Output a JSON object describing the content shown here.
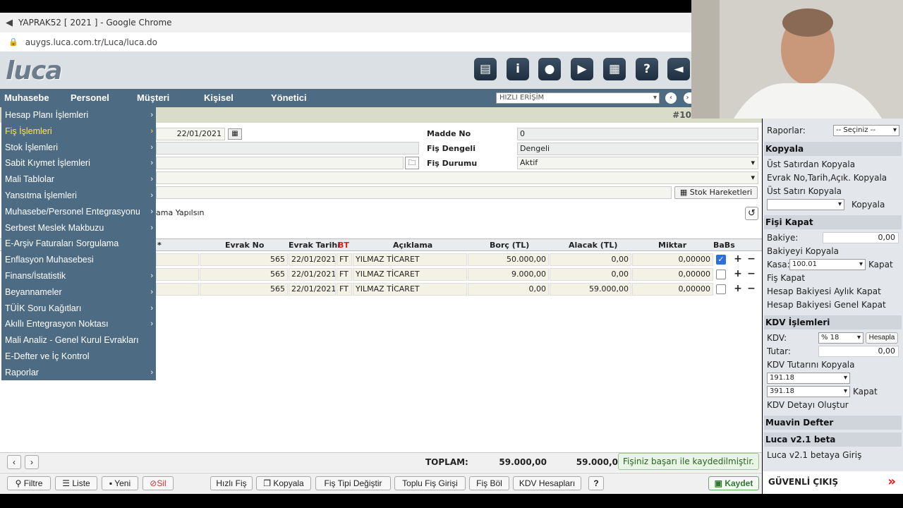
{
  "browser": {
    "title": "YAPRAK52 [ 2021 ] - Google Chrome",
    "url": "auygs.luca.com.tr/Luca/luca.do"
  },
  "logo": "luca",
  "toolbar_icons": [
    "book-icon",
    "info-icon",
    "globe-icon",
    "youtube-icon",
    "calculator-icon",
    "help-icon",
    "megaphone-icon"
  ],
  "nav": {
    "items": [
      "Muhasebe",
      "Personel",
      "Müşteri",
      "Kişisel",
      "Yönetici"
    ],
    "quick_access": "HIZLI ERİŞİM"
  },
  "fis_number": "#10",
  "form": {
    "date": "22/01/2021",
    "madde_no_label": "Madde No",
    "madde_no": "0",
    "fis_dengeli_label": "Fiş Dengeli",
    "fis_dengeli": "Dengeli",
    "fis_durumu_label": "Fiş Durumu",
    "fis_durumu": "Aktif",
    "stok_button": "Stok Hareketleri",
    "partial_text": "ama Yapılsın"
  },
  "grid": {
    "headers": [
      "*",
      "Evrak No",
      "Evrak Tarihi",
      "BT",
      "Açıklama",
      "Borç (TL)",
      "Alacak (TL)",
      "Miktar",
      "BaBs"
    ],
    "rows": [
      {
        "evrak_no": "565",
        "tarih": "22/01/2021",
        "bt": "FT",
        "aciklama": "YILMAZ TİCARET",
        "borc": "50.000,00",
        "alacak": "0,00",
        "miktar": "0,00000",
        "babs": true
      },
      {
        "evrak_no": "565",
        "tarih": "22/01/2021",
        "bt": "FT",
        "aciklama": "YILMAZ TİCARET",
        "borc": "9.000,00",
        "alacak": "0,00",
        "miktar": "0,00000",
        "babs": false
      },
      {
        "evrak_no": "565",
        "tarih": "22/01/2021",
        "bt": "FT",
        "aciklama": "YILMAZ TİCARET",
        "borc": "0,00",
        "alacak": "59.000,00",
        "miktar": "0,00000",
        "babs": false
      }
    ]
  },
  "menu": {
    "items": [
      "Hesap Planı İşlemleri",
      "Fiş İşlemleri",
      "Stok İşlemleri",
      "Sabit Kıymet İşlemleri",
      "Mali Tablolar",
      "Yansıtma İşlemleri",
      "Muhasebe/Personel Entegrasyonu",
      "Serbest Meslek Makbuzu",
      "E-Arşiv Faturaları Sorgulama",
      "Enflasyon Muhasebesi",
      "Finans/İstatistik",
      "Beyannameler",
      "TÜİK Soru Kağıtları",
      "Akıllı Entegrasyon Noktası",
      "Mali Analiz - Genel Kurul Evrakları",
      "E-Defter ve İç Kontrol",
      "Raporlar"
    ]
  },
  "totals": {
    "label": "TOPLAM:",
    "borc": "59.000,00",
    "alacak": "59.000,0"
  },
  "toast": "Fişiniz başarı ile kaydedilmiştir.",
  "bottom_buttons": {
    "filtre": "Filtre",
    "liste": "Liste",
    "yeni": "Yeni",
    "sil": "Sil",
    "hizli_fis": "Hızlı Fiş",
    "kopyala": "Kopyala",
    "fis_tipi": "Fiş Tipi Değiştir",
    "toplu": "Toplu Fiş Girişi",
    "fis_bol": "Fiş Böl",
    "kdv_hesaplari": "KDV Hesapları",
    "kaydet": "Kaydet"
  },
  "right_panel": {
    "raporlar_label": "Raporlar:",
    "raporlar_select": "-- Seçiniz --",
    "kopyala_title": "Kopyala",
    "kopyala_items": [
      "Üst Satırdan Kopyala",
      "Evrak No,Tarih,Açık. Kopyala",
      "Üst Satırı Kopyala"
    ],
    "kopyala_link": "Kopyala",
    "fisi_kapat_title": "Fişi Kapat",
    "bakiye_label": "Bakiye:",
    "bakiye_value": "0,00",
    "bakiye_kopyala": "Bakiyeyi Kopyala",
    "kasa_label": "Kasa:",
    "kasa_value": "100.01",
    "kapat": "Kapat",
    "fis_kapat": "Fiş Kapat",
    "aylik_kapat": "Hesap Bakiyesi Aylık Kapat",
    "genel_kapat": "Hesap Bakiyesi Genel Kapat",
    "kdv_title": "KDV İşlemleri",
    "kdv_label": "KDV:",
    "kdv_value": "% 18",
    "hesapla": "Hesapla",
    "tutar_label": "Tutar:",
    "tutar_value": "0,00",
    "kdv_kopyala": "KDV Tutarını Kopyala",
    "kdv_acc1": "191.18",
    "kdv_acc2": "391.18",
    "kapat2": "Kapat",
    "kdv_detay": "KDV Detayı Oluştur",
    "muavin": "Muavin Defter",
    "beta_title": "Luca v2.1 beta",
    "beta_link": "Luca v2.1 betaya Giriş",
    "cikis": "GÜVENLİ ÇIKIŞ"
  }
}
